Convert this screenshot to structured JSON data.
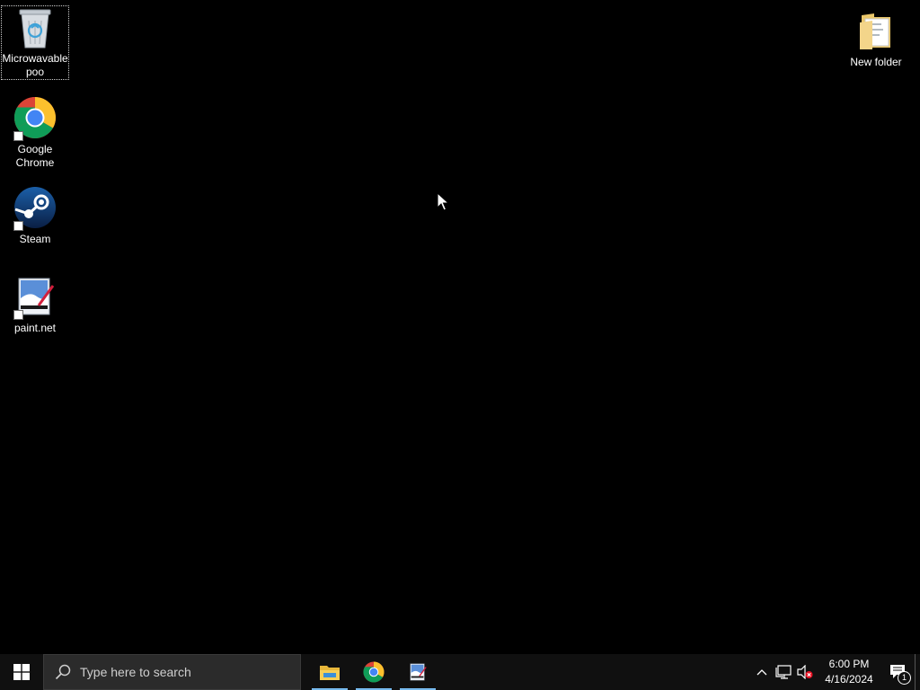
{
  "desktop": {
    "background": "#000000",
    "icons": [
      {
        "label": "Microwavable poo",
        "icon": "recycle-bin-icon"
      },
      {
        "label": "Google Chrome",
        "icon": "chrome-icon"
      },
      {
        "label": "Steam",
        "icon": "steam-icon"
      },
      {
        "label": "paint.net",
        "icon": "paintnet-icon"
      },
      {
        "label": "New folder",
        "icon": "folder-icon"
      }
    ]
  },
  "taskbar": {
    "background": "#101010",
    "search_placeholder": "Type here to search",
    "pinned": [
      {
        "name": "File Explorer",
        "icon": "file-explorer-icon"
      },
      {
        "name": "Google Chrome",
        "icon": "chrome-icon"
      },
      {
        "name": "paint.net",
        "icon": "paintnet-icon"
      }
    ],
    "accent": "#76b9ed"
  },
  "tray": {
    "time": "6:00 PM",
    "date": "4/16/2024",
    "notification_count": "1"
  }
}
